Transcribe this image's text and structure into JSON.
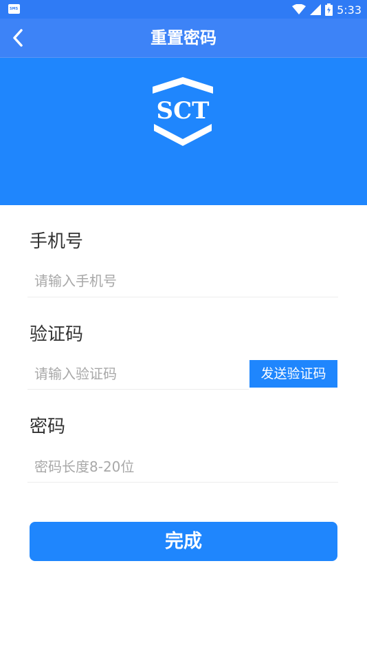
{
  "status_bar": {
    "notification_icon": "sms-icon",
    "time": "5:33",
    "icons": [
      "wifi-icon",
      "signal-icon",
      "battery-icon"
    ]
  },
  "nav": {
    "back_icon": "chevron-left-icon",
    "title": "重置密码"
  },
  "banner": {
    "logo_text": "SCT"
  },
  "form": {
    "phone": {
      "label": "手机号",
      "placeholder": "请输入手机号",
      "value": ""
    },
    "code": {
      "label": "验证码",
      "placeholder": "请输入验证码",
      "value": "",
      "send_button": "发送验证码"
    },
    "password": {
      "label": "密码",
      "placeholder": "密码长度8-20位",
      "value": ""
    },
    "submit_label": "完成"
  },
  "colors": {
    "status_bar": "#2f7bf5",
    "nav_bar": "#3d83f7",
    "primary": "#1f86fd",
    "label_text": "#333333",
    "placeholder_text": "#a8a8a8"
  }
}
